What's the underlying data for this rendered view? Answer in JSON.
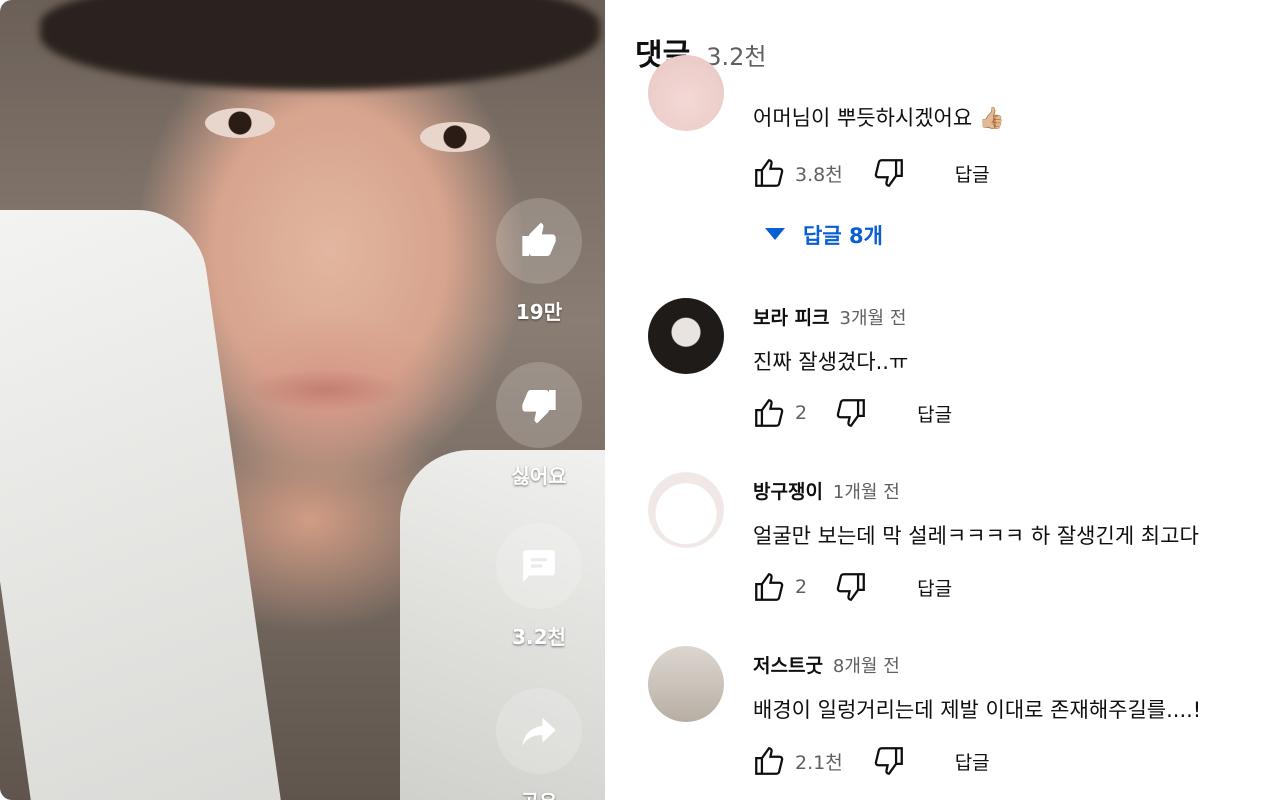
{
  "video": {
    "like_count": "19만",
    "dislike_label": "싫어요",
    "comment_count": "3.2천",
    "share_label": "공유"
  },
  "comments_panel": {
    "title": "댓글",
    "count": "3.2천",
    "comments": [
      {
        "author": "",
        "time": "",
        "text": "어머님이 뿌듯하시겠어요 👍🏼",
        "likes": "3.8천",
        "reply_label": "답글",
        "replies_toggle": "답글 8개"
      },
      {
        "author": "보라 피크",
        "time": "3개월 전",
        "text": "진짜 잘생겼다..ㅠ",
        "likes": "2",
        "reply_label": "답글"
      },
      {
        "author": "방구쟁이",
        "time": "1개월 전",
        "text": "얼굴만 보는데 막 설레ㅋㅋㅋㅋ 하 잘생긴게 최고다",
        "likes": "2",
        "reply_label": "답글"
      },
      {
        "author": "저스트굿",
        "time": "8개월 전",
        "text": "배경이 일렁거리는데 제발 이대로 존재해주길를....!",
        "likes": "2.1천",
        "reply_label": "답글"
      }
    ]
  },
  "colors": {
    "link_blue": "#065fd4",
    "secondary_text": "#606060"
  }
}
